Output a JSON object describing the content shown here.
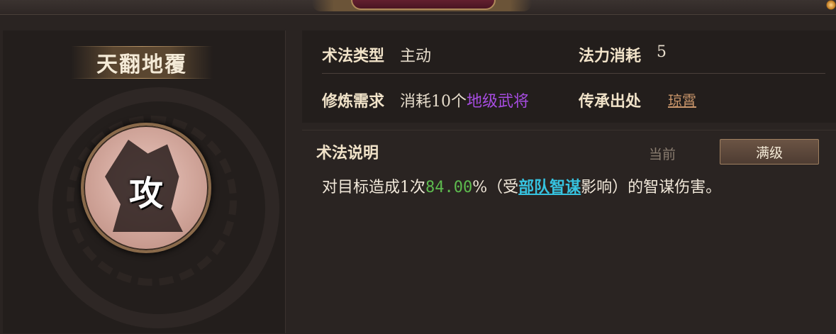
{
  "header": {
    "title": ""
  },
  "skill": {
    "name": "天翻地覆",
    "emblem_char": "攻"
  },
  "info": {
    "type_label": "术法类型",
    "type_value": "主动",
    "cost_label": "法力消耗",
    "cost_value": "5",
    "train_label": "修炼需求",
    "train_value_prefix": "消耗10个",
    "train_value_highlight": "地级武将",
    "origin_label": "传承出处",
    "origin_value": "琼霄"
  },
  "description": {
    "title": "术法说明",
    "tab_current": "当前",
    "tab_max": "满级",
    "text_part1": "对目标造成1次",
    "text_value": "84.00",
    "text_part2": "%（受",
    "text_link": "部队智谋",
    "text_part3": "影响）的智谋伤害。"
  },
  "colors": {
    "highlight_purple": "#a64ce0",
    "value_green": "#5dbb4e",
    "link_cyan": "#36c3e0",
    "origin_link": "#c9956a"
  }
}
